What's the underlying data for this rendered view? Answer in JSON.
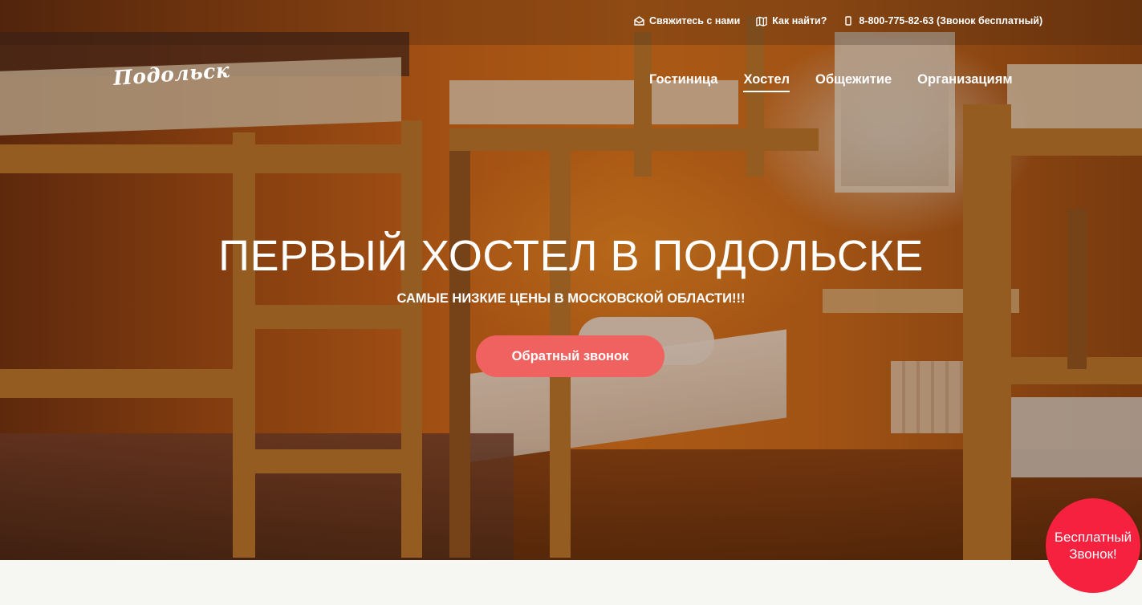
{
  "topbar": {
    "contact": {
      "label": "Свяжитесь с нами",
      "icon": "envelope-icon"
    },
    "directions": {
      "label": "Как найти?",
      "icon": "map-icon"
    },
    "phone": {
      "label": "8-800-775-82-63 (Звонок бесплатный)",
      "icon": "phone-icon"
    }
  },
  "logo": {
    "text": "Подольск"
  },
  "nav": {
    "items": [
      {
        "label": "Гостиница",
        "active": false
      },
      {
        "label": "Хостел",
        "active": true
      },
      {
        "label": "Общежитие",
        "active": false
      },
      {
        "label": "Организациям",
        "active": false
      }
    ]
  },
  "hero": {
    "title": "ПЕРВЫЙ ХОСТЕЛ В ПОДОЛЬСКЕ",
    "subtitle": "САМЫЕ НИЗКИЕ ЦЕНЫ В МОСКОВСКОЙ ОБЛАСТИ!!!",
    "cta_label": "Обратный звонок"
  },
  "free_call": {
    "line1": "Бесплатный",
    "line2": "Звонок!"
  },
  "colors": {
    "cta": "#f0625f",
    "free_call": "#f5213f",
    "hero_tint": "#c9651a",
    "page_bg": "#f6f6f3"
  }
}
